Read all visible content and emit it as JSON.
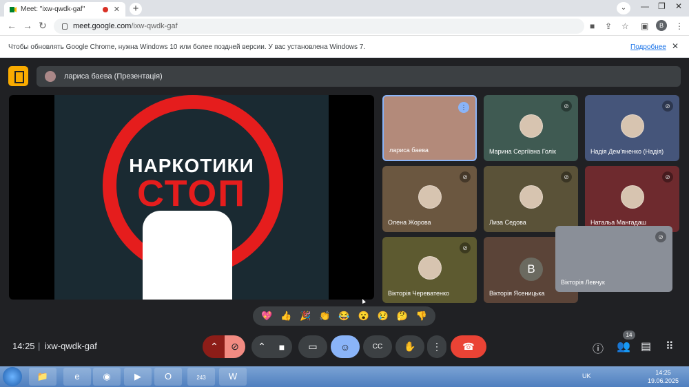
{
  "browser": {
    "tab_title": "Meet: \"ixw-qwdk-gaf\"",
    "url_host": "meet.google.com",
    "url_path": "/ixw-qwdk-gaf",
    "profile_initial": "B"
  },
  "infobar": {
    "message": "Чтобы обновлять Google Chrome, нужна Windows 10 или более поздней версии. У вас установлена Windows 7.",
    "link": "Подробнее"
  },
  "meet": {
    "presenter_label": "лариса баева (Презентація)",
    "slide": {
      "line1": "НАРКОТИКИ",
      "line2": "СТОП"
    },
    "participants": [
      {
        "name": "лариса баева",
        "bg": "#b38a7a",
        "mic": "speaking"
      },
      {
        "name": "Марина Сергіївна Голік",
        "bg": "#3f5a52",
        "mic": "muted"
      },
      {
        "name": "Надія Дем'яненко (Надія)",
        "bg": "#45557a",
        "mic": "muted"
      },
      {
        "name": "Олена Жорова",
        "bg": "#6b5740",
        "mic": "muted"
      },
      {
        "name": "Лиза Седова",
        "bg": "#5a5238",
        "mic": "muted"
      },
      {
        "name": "Натальа Мангадаш",
        "bg": "#6e2a2e",
        "mic": "muted"
      },
      {
        "name": "Вікторія Череватенко",
        "bg": "#5d5a30",
        "mic": "muted"
      },
      {
        "name": "Вікторія Ясеницька",
        "bg": "#5b4438",
        "letter": "B",
        "mic": "muted"
      },
      {
        "name": "Вікторія Левчук",
        "bg": "#8a8f98",
        "mic": "muted"
      }
    ],
    "reactions": [
      "💖",
      "👍",
      "🎉",
      "👏",
      "😂",
      "😮",
      "😢",
      "🤔",
      "👎"
    ],
    "time": "14:25",
    "meeting_code": "ixw-qwdk-gaf",
    "participant_count": "14"
  },
  "taskbar": {
    "lang": "UK",
    "clock_time": "14:25",
    "clock_date": "19.06.2025",
    "viber_badge": "243"
  },
  "colors": {
    "accent": "#8ab4f8",
    "end_call": "#ea4335",
    "mic_off": "#8c1d18"
  }
}
